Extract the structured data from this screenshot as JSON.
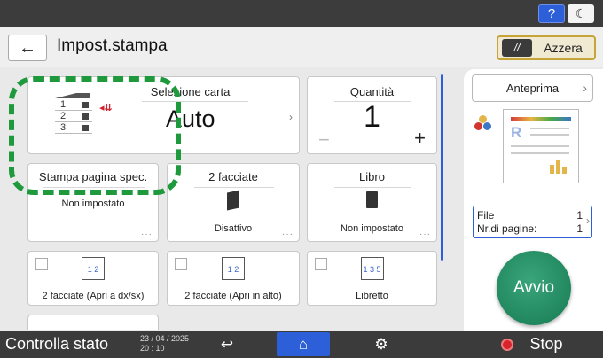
{
  "topbar": {
    "help_label": "?",
    "night_label": "☾"
  },
  "header": {
    "back_label": "←",
    "title": "Impost.stampa",
    "reset_label": "Azzera"
  },
  "paper": {
    "title": "Selezione carta",
    "value": "Auto",
    "tray_numbers": [
      "1",
      "2",
      "3"
    ]
  },
  "quantity": {
    "title": "Quantità",
    "value": "1",
    "minus": "−",
    "plus": "+"
  },
  "cards_row2": {
    "spec": {
      "title": "Stampa pagina spec.",
      "value": "Non impostato"
    },
    "duplex": {
      "title": "2 facciate",
      "value": "Disattivo"
    },
    "book": {
      "title": "Libro",
      "value": "Non impostato"
    }
  },
  "cards_row3": {
    "a": {
      "label": "2 facciate (Apri a dx/sx)",
      "icon_text": "1 2"
    },
    "b": {
      "label": "2 facciate (Apri in alto)",
      "icon_text": "1 2"
    },
    "c": {
      "label": "Libretto",
      "icon_text": "1 3 5"
    }
  },
  "side": {
    "preview_label": "Anteprima",
    "files_label": "File",
    "files_value": "1",
    "pages_label": "Nr.di pagine:",
    "pages_value": "1",
    "start_label": "Avvio"
  },
  "bottombar": {
    "status_label": "Controlla stato",
    "date": "23 / 04 / 2025",
    "time": "20 : 10",
    "stop_label": "Stop"
  },
  "colors": {
    "accent_blue": "#2c5fd8",
    "highlight_green": "#1e9a3c",
    "start_green": "#167a52",
    "stop_red": "#d8222d"
  }
}
